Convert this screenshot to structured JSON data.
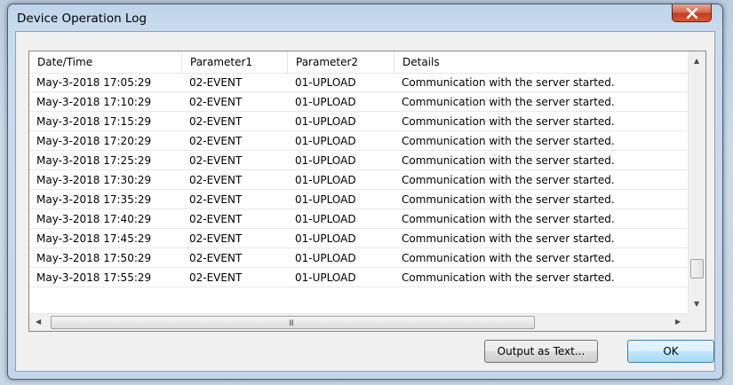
{
  "window": {
    "title": "Device Operation Log",
    "close_glyph": "x"
  },
  "table": {
    "columns": [
      "Date/Time",
      "Parameter1",
      "Parameter2",
      "Details"
    ],
    "rows": [
      [
        "May-3-2018 17:05:29",
        "02-EVENT",
        "01-UPLOAD",
        "Communication with the server started."
      ],
      [
        "May-3-2018 17:10:29",
        "02-EVENT",
        "01-UPLOAD",
        "Communication with the server started."
      ],
      [
        "May-3-2018 17:15:29",
        "02-EVENT",
        "01-UPLOAD",
        "Communication with the server started."
      ],
      [
        "May-3-2018 17:20:29",
        "02-EVENT",
        "01-UPLOAD",
        "Communication with the server started."
      ],
      [
        "May-3-2018 17:25:29",
        "02-EVENT",
        "01-UPLOAD",
        "Communication with the server started."
      ],
      [
        "May-3-2018 17:30:29",
        "02-EVENT",
        "01-UPLOAD",
        "Communication with the server started."
      ],
      [
        "May-3-2018 17:35:29",
        "02-EVENT",
        "01-UPLOAD",
        "Communication with the server started."
      ],
      [
        "May-3-2018 17:40:29",
        "02-EVENT",
        "01-UPLOAD",
        "Communication with the server started."
      ],
      [
        "May-3-2018 17:45:29",
        "02-EVENT",
        "01-UPLOAD",
        "Communication with the server started."
      ],
      [
        "May-3-2018 17:50:29",
        "02-EVENT",
        "01-UPLOAD",
        "Communication with the server started."
      ],
      [
        "May-3-2018 17:55:29",
        "02-EVENT",
        "01-UPLOAD",
        "Communication with the server started."
      ]
    ]
  },
  "scrollbars": {
    "vertical": {
      "position_fraction": 0.95
    },
    "horizontal": {
      "position_fraction": 0.0,
      "grip": "III"
    }
  },
  "buttons": {
    "output_label": "Output as Text...",
    "ok_label": "OK"
  },
  "icons": {
    "close": "close-icon",
    "scroll_up": "arrow-up-icon",
    "scroll_down": "arrow-down-icon",
    "scroll_left": "arrow-left-icon",
    "scroll_right": "arrow-right-icon"
  },
  "colors": {
    "title_bar": "#c3d6ea",
    "close_button": "#c9452a",
    "ok_border": "#3c7fb1"
  }
}
